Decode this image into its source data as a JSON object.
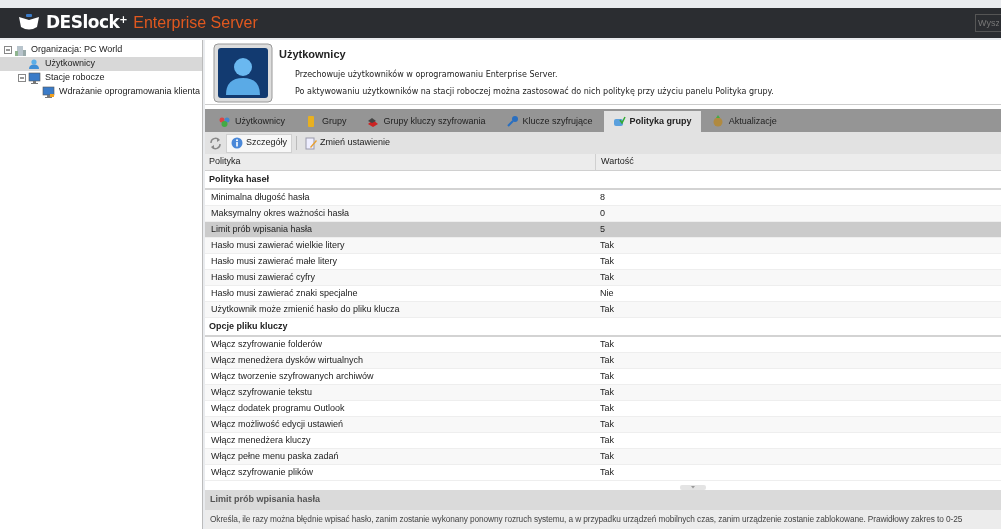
{
  "header": {
    "brand": "DESlock",
    "brand_sup": "+",
    "product": "Enterprise Server",
    "search": {
      "placeholder": "Wysz"
    }
  },
  "tree": [
    {
      "label": "Organizacja: PC World",
      "kind": "organization",
      "expanded": true,
      "selected": false,
      "children": [
        {
          "label": "Użytkownicy",
          "kind": "users",
          "selected": true
        },
        {
          "label": "Stacje robocze",
          "kind": "workstations",
          "expanded": true,
          "selected": false,
          "children": [
            {
              "label": "Wdrażanie oprogramowania klienta",
              "kind": "computer",
              "selected": false
            }
          ]
        }
      ]
    }
  ],
  "info": {
    "title": "Użytkownicy",
    "lines": [
      "Przechowuje użytkowników w oprogramowaniu Enterprise Server.",
      "Po aktywowaniu użytkowników na stacji roboczej można zastosować do nich politykę przy użyciu panelu Polityka grupy."
    ]
  },
  "tabs": [
    {
      "label": "Użytkownicy",
      "selected": false
    },
    {
      "label": "Grupy",
      "selected": false
    },
    {
      "label": "Grupy kluczy szyfrowania",
      "selected": false
    },
    {
      "label": "Klucze szyfrujące",
      "selected": false
    },
    {
      "label": "Polityka grupy",
      "selected": true
    },
    {
      "label": "Aktualizacje",
      "selected": false
    }
  ],
  "toolbar": [
    {
      "kind": "refresh"
    },
    {
      "kind": "details",
      "label": "Szczegóły",
      "selected": true
    },
    {
      "kind": "edit",
      "label": "Zmień ustawienie",
      "selected": false
    }
  ],
  "table": {
    "columns": [
      "Polityka",
      "Wartość"
    ],
    "rows": [
      {
        "kind": "group",
        "label": "Polityka haseł"
      },
      {
        "kind": "setting",
        "policy": "Minimalna długość hasła",
        "value": "8",
        "selected": false
      },
      {
        "kind": "setting",
        "policy": "Maksymalny okres ważności hasła",
        "value": "0",
        "selected": false
      },
      {
        "kind": "setting",
        "policy": "Limit prób wpisania hasła",
        "value": "5",
        "selected": true
      },
      {
        "kind": "setting",
        "policy": "Hasło musi zawierać wielkie litery",
        "value": "Tak",
        "selected": false
      },
      {
        "kind": "setting",
        "policy": "Hasło musi zawierać małe litery",
        "value": "Tak",
        "selected": false
      },
      {
        "kind": "setting",
        "policy": "Hasło musi zawierać cyfry",
        "value": "Tak",
        "selected": false
      },
      {
        "kind": "setting",
        "policy": "Hasło musi zawierać znaki specjalne",
        "value": "Nie",
        "selected": false
      },
      {
        "kind": "setting",
        "policy": "Użytkownik może zmienić hasło do pliku klucza",
        "value": "Tak",
        "selected": false
      },
      {
        "kind": "group",
        "label": "Opcje pliku kluczy"
      },
      {
        "kind": "setting",
        "policy": "Włącz szyfrowanie folderów",
        "value": "Tak",
        "selected": false
      },
      {
        "kind": "setting",
        "policy": "Włącz menedżera dysków wirtualnych",
        "value": "Tak",
        "selected": false
      },
      {
        "kind": "setting",
        "policy": "Włącz tworzenie szyfrowanych archiwów",
        "value": "Tak",
        "selected": false
      },
      {
        "kind": "setting",
        "policy": "Włącz szyfrowanie tekstu",
        "value": "Tak",
        "selected": false
      },
      {
        "kind": "setting",
        "policy": "Włącz dodatek programu Outlook",
        "value": "Tak",
        "selected": false
      },
      {
        "kind": "setting",
        "policy": "Włącz możliwość edycji ustawień",
        "value": "Tak",
        "selected": false
      },
      {
        "kind": "setting",
        "policy": "Włącz menedżera kluczy",
        "value": "Tak",
        "selected": false
      },
      {
        "kind": "setting",
        "policy": "Włącz pełne menu paska zadań",
        "value": "Tak",
        "selected": false
      },
      {
        "kind": "setting",
        "policy": "Włącz szyfrowanie plików",
        "value": "Tak",
        "selected": false
      }
    ]
  },
  "detail": {
    "title": "Limit prób wpisania hasła",
    "text": "Określa, ile razy można błędnie wpisać hasło, zanim zostanie wykonany ponowny rozruch systemu, a w przypadku urządzeń mobilnych czas, zanim urządzenie zostanie zablokowane. Prawidłowy zakres to 0-25"
  }
}
